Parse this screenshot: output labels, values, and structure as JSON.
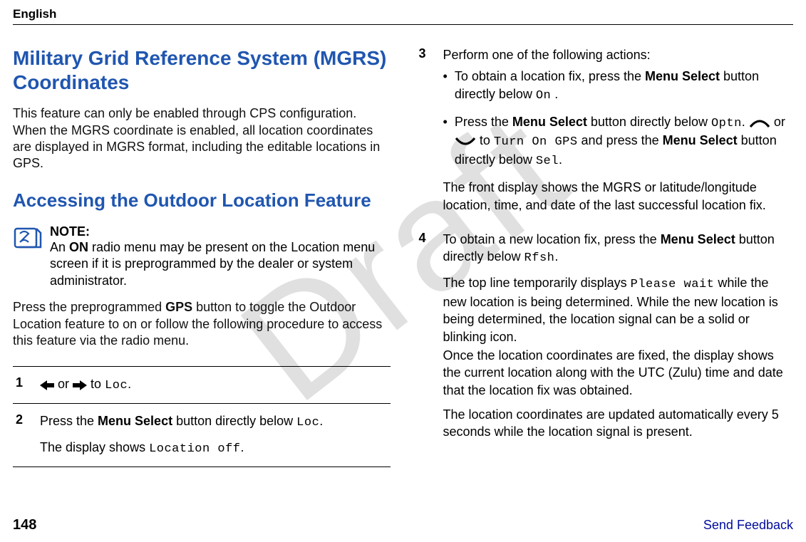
{
  "language": "English",
  "watermark": "Draft",
  "left": {
    "h1": "Military Grid Reference System (MGRS) Coordinates",
    "p1": "This feature can only be enabled through CPS configuration. When the MGRS coordinate is enabled, all location coordinates are displayed in MGRS format, including the editable locations in GPS.",
    "h2": "Accessing the Outdoor Location Feature",
    "note_title": "NOTE:",
    "note_body_a": "An ",
    "note_body_bold": "ON",
    "note_body_b": " radio menu may be present on the Location menu screen if it is preprogrammed by the dealer or system administrator.",
    "p2a": "Press the preprogrammed ",
    "p2bold": "GPS",
    "p2b": " button to toggle the Outdoor Location feature to on or follow the following procedure to access this feature via the radio menu.",
    "steps": [
      {
        "num": "1",
        "pre": "",
        "or": " or ",
        "post": " to ",
        "mono": "Loc",
        "end": "."
      },
      {
        "num": "2",
        "line1a": "Press the ",
        "line1bold": "Menu Select",
        "line1b": " button directly below ",
        "line1mono": "Loc",
        "line1end": ".",
        "line2a": "The display shows ",
        "line2mono": "Location off",
        "line2end": "."
      }
    ]
  },
  "right": {
    "steps": [
      {
        "num": "3",
        "intro": "Perform one of the following actions:",
        "b1a": "To obtain a location fix, press the ",
        "b1bold": "Menu Select",
        "b1b": " button directly below ",
        "b1mono": "On",
        "b1end": " .",
        "b2a": "Press the ",
        "b2bold1": "Menu Select",
        "b2b": " button directly below ",
        "b2mono1": "Optn",
        "b2c": ". ",
        "b2or": " or ",
        "b2d": " to ",
        "b2mono2": "Turn On GPS",
        "b2e": " and press the ",
        "b2bold2": "Menu Select",
        "b2f": " button directly below ",
        "b2mono3": "Sel",
        "b2end": ".",
        "result": "The front display shows the MGRS or latitude/longitude location, time, and date of the last successful location fix."
      },
      {
        "num": "4",
        "l1a": "To obtain a new location fix, press the ",
        "l1bold": "Menu Select",
        "l1b": " button directly below ",
        "l1mono": "Rfsh",
        "l1end": ".",
        "l2a": "The top line temporarily displays ",
        "l2mono": "Please wait",
        "l2b": " while the new location is being determined. While the new location is being determined, the location signal can be a solid or blinking icon.",
        "l3": "Once the location coordinates are fixed, the display shows the current location along with the UTC (Zulu) time and date that the location fix was obtained.",
        "l4": "The location coordinates are updated automatically every 5 seconds while the location signal is present."
      }
    ]
  },
  "footer": {
    "page": "148",
    "feedback": "Send Feedback"
  }
}
